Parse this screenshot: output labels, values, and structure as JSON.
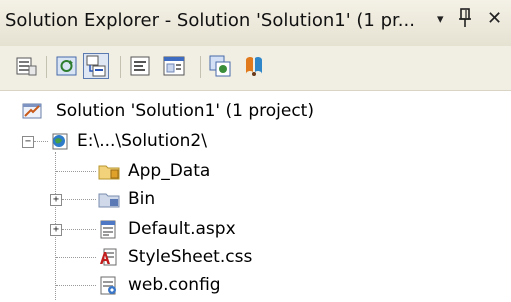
{
  "window": {
    "title": "Solution Explorer - Solution 'Solution1' (1 pr...",
    "dropdown_glyph": "▾",
    "pin_glyph": "⊥",
    "close_glyph": "✕"
  },
  "toolbar": {
    "buttons": [
      {
        "name": "properties-icon"
      },
      {
        "name": "refresh-icon"
      },
      {
        "name": "nest-related-files-icon",
        "pressed": true
      },
      {
        "name": "view-code-icon"
      },
      {
        "name": "view-designer-icon"
      },
      {
        "name": "copy-website-icon"
      },
      {
        "name": "asp-net-configuration-icon"
      }
    ]
  },
  "tree": {
    "solution": {
      "label": "Solution 'Solution1' (1 project)",
      "icon": "solution-icon"
    },
    "project": {
      "label": "E:\\...\\Solution2\\",
      "icon": "web-project-icon",
      "expander": "−"
    },
    "items": [
      {
        "label": "App_Data",
        "icon": "folder-icon",
        "expander": ""
      },
      {
        "label": "Bin",
        "icon": "folder-icon",
        "expander": "+"
      },
      {
        "label": "Default.aspx",
        "icon": "aspx-file-icon",
        "expander": "+"
      },
      {
        "label": "StyleSheet.css",
        "icon": "css-file-icon",
        "expander": ""
      },
      {
        "label": "web.config",
        "icon": "config-file-icon",
        "expander": ""
      }
    ]
  }
}
